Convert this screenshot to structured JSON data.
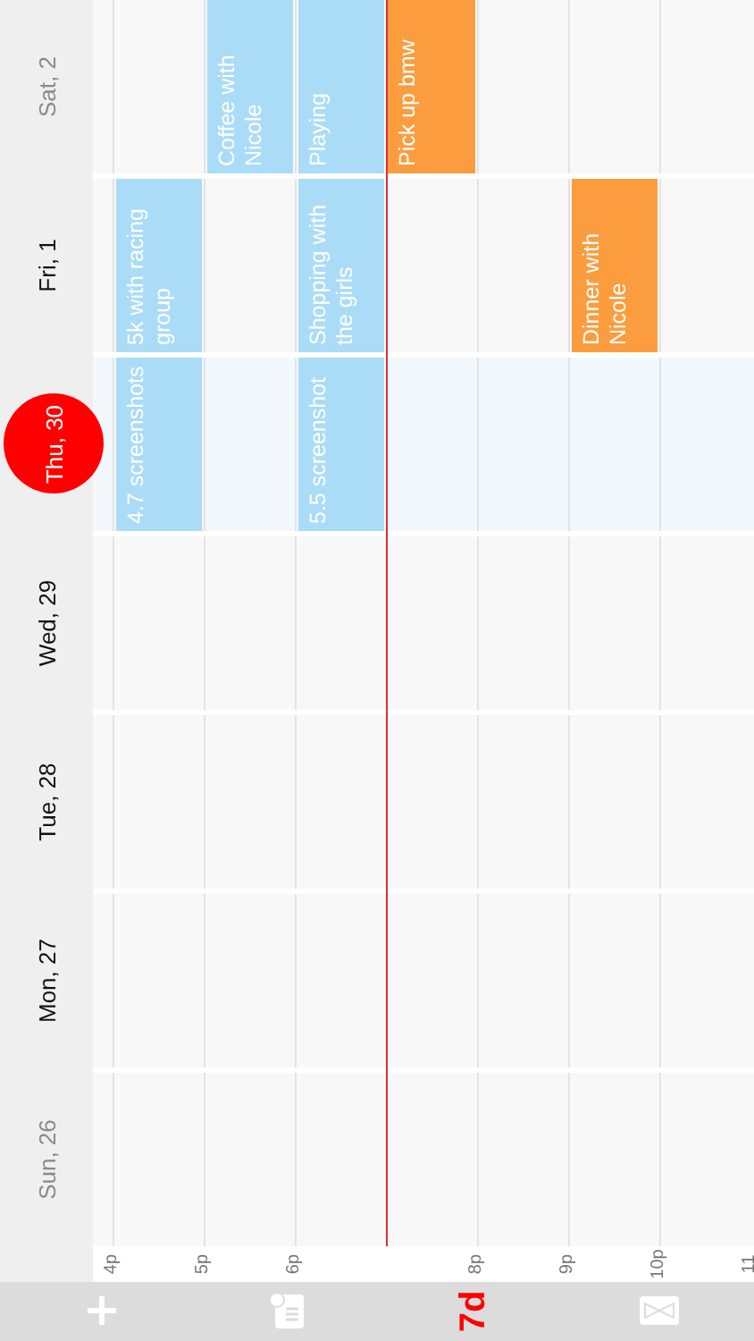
{
  "toolbar": [
    {
      "kind": "add"
    },
    {
      "kind": "calendar"
    },
    {
      "kind": "view",
      "label": "7d"
    },
    {
      "kind": "timer"
    }
  ],
  "hours": [
    {
      "label": "4p",
      "now": false
    },
    {
      "label": "5p",
      "now": false
    },
    {
      "label": "6p",
      "now": false
    },
    {
      "now": true
    },
    {
      "label": "8p",
      "now": false
    },
    {
      "label": "9p",
      "now": false
    },
    {
      "label": "10p",
      "now": false
    },
    {
      "label": "11",
      "now": false
    }
  ],
  "days": [
    {
      "label": "Sun, 26",
      "weekend": true,
      "today": false
    },
    {
      "label": "Mon, 27",
      "weekend": false,
      "today": false
    },
    {
      "label": "Tue, 28",
      "weekend": false,
      "today": false
    },
    {
      "label": "Wed, 29",
      "weekend": false,
      "today": false
    },
    {
      "label": "Thu, 30",
      "weekend": false,
      "today": true,
      "slots": [
        {
          "kind": "event",
          "title": "4.7 screenshots",
          "color": "#abdcf7"
        },
        {
          "kind": "empty"
        },
        {
          "kind": "event",
          "title": "5.5 screenshot",
          "color": "#abdcf7"
        }
      ]
    },
    {
      "label": "Fri, 1",
      "weekend": false,
      "today": false,
      "slots": [
        {
          "kind": "event",
          "title": "5k with racing group",
          "color": "#abdcf7"
        },
        {
          "kind": "empty"
        },
        {
          "kind": "event",
          "title": "Shopping with the girls",
          "color": "#abdcf7"
        },
        {
          "kind": "empty"
        },
        {
          "kind": "empty"
        },
        {
          "kind": "event",
          "title": "Dinner with Nicole",
          "color": "#fb9d3f"
        }
      ]
    },
    {
      "label": "Sat, 2",
      "weekend": true,
      "today": false,
      "slots": [
        {
          "kind": "empty"
        },
        {
          "kind": "event",
          "title": "Coffee with Nicole",
          "color": "#abdcf7"
        },
        {
          "kind": "event",
          "title": "Playing",
          "color": "#abdcf7"
        },
        {
          "kind": "event",
          "title": "Pick up bmw",
          "color": "#fb9d3f"
        }
      ]
    }
  ]
}
